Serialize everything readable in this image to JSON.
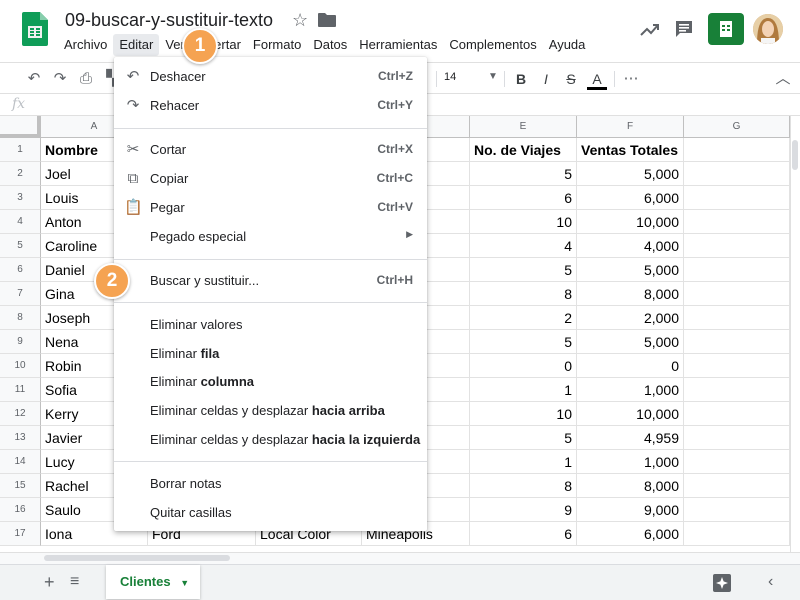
{
  "window": {
    "title": "09-buscar-y-sustituir-texto"
  },
  "menu": [
    "Archivo",
    "Editar",
    "Ver",
    "Insertar",
    "Formato",
    "Datos",
    "Herramientas",
    "Complementos",
    "Ayuda"
  ],
  "toolbar": {
    "font_size": "14"
  },
  "columns": [
    "A",
    "B",
    "C",
    "D",
    "E",
    "F",
    "G"
  ],
  "rows": [
    [
      "Nombre",
      "",
      "",
      "",
      "No. de Viajes",
      "Ventas Totales"
    ],
    [
      "Joel",
      "",
      "",
      "lis",
      "5",
      "5,000"
    ],
    [
      "Louis",
      "",
      "",
      "Aires",
      "6",
      "6,000"
    ],
    [
      "Anton",
      "",
      "",
      "lis",
      "10",
      "10,000"
    ],
    [
      "Caroline",
      "",
      "",
      "",
      "4",
      "4,000"
    ],
    [
      "Daniel",
      "",
      "",
      "",
      "5",
      "5,000"
    ],
    [
      "Gina",
      "",
      "",
      "lis",
      "8",
      "8,000"
    ],
    [
      "Joseph",
      "",
      "",
      "Aires",
      "2",
      "2,000"
    ],
    [
      "Nena",
      "",
      "",
      "",
      "5",
      "5,000"
    ],
    [
      "Robin",
      "",
      "",
      "lis",
      "0",
      "0"
    ],
    [
      "Sofia",
      "",
      "",
      "Aires",
      "1",
      "1,000"
    ],
    [
      "Kerry",
      "",
      "",
      "Aires",
      "10",
      "10,000"
    ],
    [
      "Javier",
      "",
      "",
      "",
      "5",
      "4,959"
    ],
    [
      "Lucy",
      "",
      "",
      "lis",
      "1",
      "1,000"
    ],
    [
      "Rachel",
      "",
      "",
      "",
      "8",
      "8,000"
    ],
    [
      "Saulo",
      "",
      "",
      "lis",
      "9",
      "9,000"
    ],
    [
      "Iona",
      "Ford",
      "Local Color",
      "Mineapolis",
      "6",
      "6,000"
    ]
  ],
  "edit_menu": {
    "undo": {
      "label": "Deshacer",
      "shortcut": "Ctrl+Z"
    },
    "redo": {
      "label": "Rehacer",
      "shortcut": "Ctrl+Y"
    },
    "cut": {
      "label": "Cortar",
      "shortcut": "Ctrl+X"
    },
    "copy": {
      "label": "Copiar",
      "shortcut": "Ctrl+C"
    },
    "paste": {
      "label": "Pegar",
      "shortcut": "Ctrl+V"
    },
    "paste_special": {
      "label": "Pegado especial"
    },
    "find_replace": {
      "label": "Buscar y sustituir...",
      "shortcut": "Ctrl+H"
    },
    "clear_values": {
      "label": "Eliminar valores"
    },
    "delete_row": {
      "pre": "Eliminar ",
      "bold": "fila"
    },
    "delete_column": {
      "pre": "Eliminar ",
      "bold": "columna"
    },
    "delete_cells_up": {
      "pre": "Eliminar celdas y desplazar ",
      "bold": "hacia arriba"
    },
    "delete_cells_left": {
      "pre": "Eliminar celdas y desplazar ",
      "bold": "hacia la izquierda"
    },
    "clear_notes": {
      "label": "Borrar notas"
    },
    "remove_checkboxes": {
      "label": "Quitar casillas"
    }
  },
  "sheet_tab": {
    "label": "Clientes"
  },
  "callouts": [
    "1",
    "2"
  ],
  "colors": {
    "accent": "#188038",
    "callout": "#f5a352",
    "menu_active": "#e8eaed"
  }
}
